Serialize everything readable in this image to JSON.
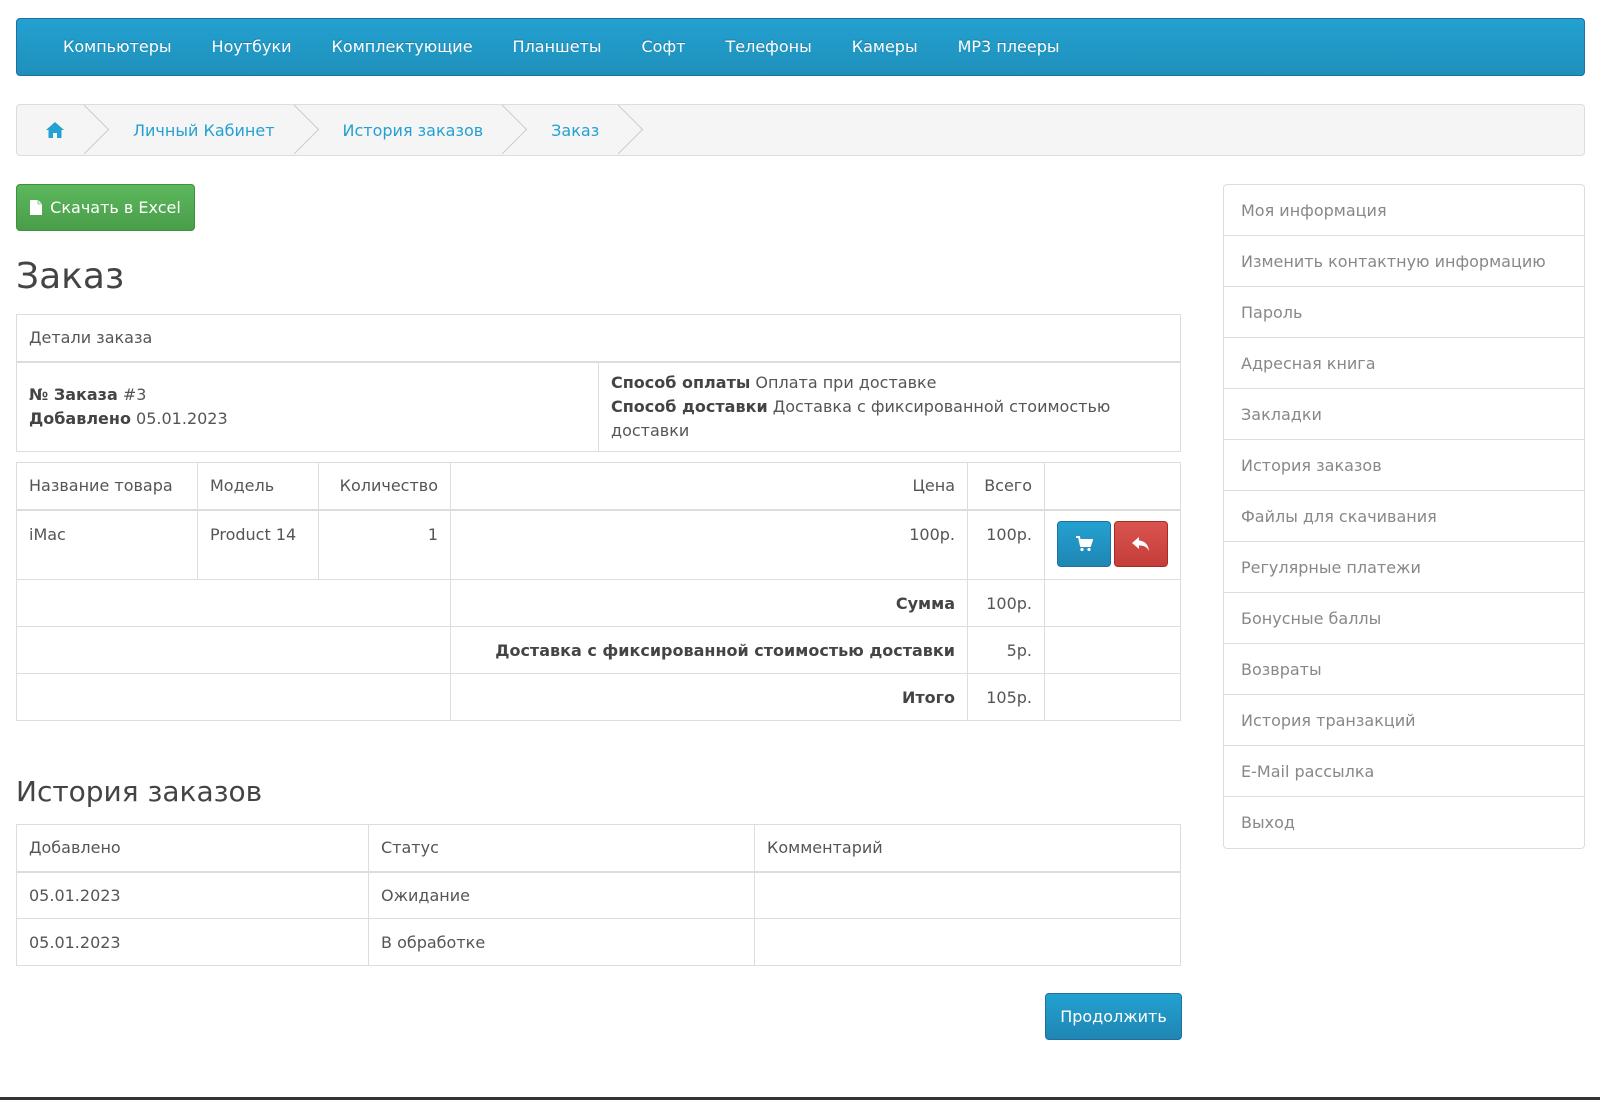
{
  "menu": [
    "Компьютеры",
    "Ноутбуки",
    "Комплектующие",
    "Планшеты",
    "Софт",
    "Телефоны",
    "Камеры",
    "MP3 плееры"
  ],
  "breadcrumb": {
    "home_icon": "home-icon",
    "items": [
      "Личный Кабинет",
      "История заказов",
      "Заказ"
    ]
  },
  "excel_button": {
    "label": "Скачать в Excel",
    "icon": "file-icon"
  },
  "page_title": "Заказ",
  "order_details": {
    "header": "Детали заказа",
    "order_no_label": "№ Заказа",
    "order_no": "#3",
    "added_label": "Добавлено",
    "added": "05.01.2023",
    "payment_label": "Способ оплаты",
    "payment": "Оплата при доставке",
    "shipping_label": "Способ доставки",
    "shipping": "Доставка с фиксированной стоимостью доставки"
  },
  "products": {
    "columns": [
      "Название товара",
      "Модель",
      "Количество",
      "Цена",
      "Всего"
    ],
    "rows": [
      {
        "name": "iMac",
        "model": "Product 14",
        "quantity": "1",
        "price": "100р.",
        "total": "100р."
      }
    ],
    "totals": [
      {
        "label": "Сумма",
        "value": "100р."
      },
      {
        "label": "Доставка с фиксированной стоимостью доставки",
        "value": "5р."
      },
      {
        "label": "Итого",
        "value": "105р."
      }
    ],
    "colors": {
      "reorder": "#23a1d1",
      "return": "#d9534f"
    }
  },
  "history": {
    "title": "История заказов",
    "columns": [
      "Добавлено",
      "Статус",
      "Комментарий"
    ],
    "rows": [
      {
        "date": "05.01.2023",
        "status": "Ожидание",
        "comment": ""
      },
      {
        "date": "05.01.2023",
        "status": "В обработке",
        "comment": ""
      }
    ]
  },
  "continue_button": "Продолжить",
  "sidebar": [
    "Моя информация",
    "Изменить контактную информацию",
    "Пароль",
    "Адресная книга",
    "Закладки",
    "История заказов",
    "Файлы для скачивания",
    "Регулярные платежи",
    "Бонусные баллы",
    "Возвраты",
    "История транзакций",
    "E-Mail рассылка",
    "Выход"
  ],
  "accent_color": "#23a1d1"
}
